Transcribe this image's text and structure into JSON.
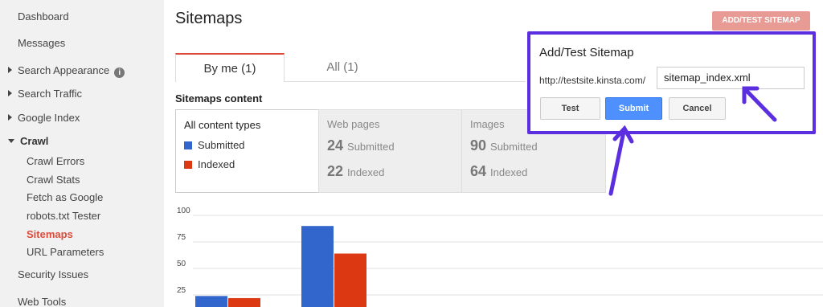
{
  "sidebar": {
    "dashboard": "Dashboard",
    "messages": "Messages",
    "search_appearance": "Search Appearance",
    "search_traffic": "Search Traffic",
    "google_index": "Google Index",
    "crawl": "Crawl",
    "crawl_items": [
      "Crawl Errors",
      "Crawl Stats",
      "Fetch as Google",
      "robots.txt Tester",
      "Sitemaps",
      "URL Parameters"
    ],
    "security_issues": "Security Issues",
    "web_tools": "Web Tools",
    "info_icon": "i"
  },
  "main": {
    "title": "Sitemaps",
    "add_button": "ADD/TEST SITEMAP",
    "tabs": [
      "By me (1)",
      "All (1)"
    ],
    "sitemaps_content_label": "Sitemaps content",
    "content_types": {
      "title": "All content types",
      "legend": [
        {
          "label": "Submitted",
          "color": "#3366cc"
        },
        {
          "label": "Indexed",
          "color": "#dc3912"
        }
      ]
    },
    "web_pages": {
      "title": "Web pages",
      "submitted_count": "24",
      "submitted_label": "Submitted",
      "indexed_count": "22",
      "indexed_label": "Indexed"
    },
    "images": {
      "title": "Images",
      "submitted_count": "90",
      "submitted_label": "Submitted",
      "indexed_count": "64",
      "indexed_label": "Indexed"
    }
  },
  "chart_data": {
    "type": "bar",
    "categories": [
      "Web pages",
      "Images"
    ],
    "series": [
      {
        "name": "Submitted",
        "values": [
          24,
          90
        ],
        "color": "#3366cc"
      },
      {
        "name": "Indexed",
        "values": [
          22,
          64
        ],
        "color": "#dc3912"
      }
    ],
    "y_ticks": [
      "100",
      "75",
      "50",
      "25"
    ],
    "ylim": [
      0,
      100
    ],
    "grid": true
  },
  "dialog": {
    "title": "Add/Test Sitemap",
    "url_prefix": "http://testsite.kinsta.com/",
    "input_value": "sitemap_index.xml",
    "buttons": {
      "test": "Test",
      "submit": "Submit",
      "cancel": "Cancel"
    },
    "border_color": "#5b2fe0"
  }
}
